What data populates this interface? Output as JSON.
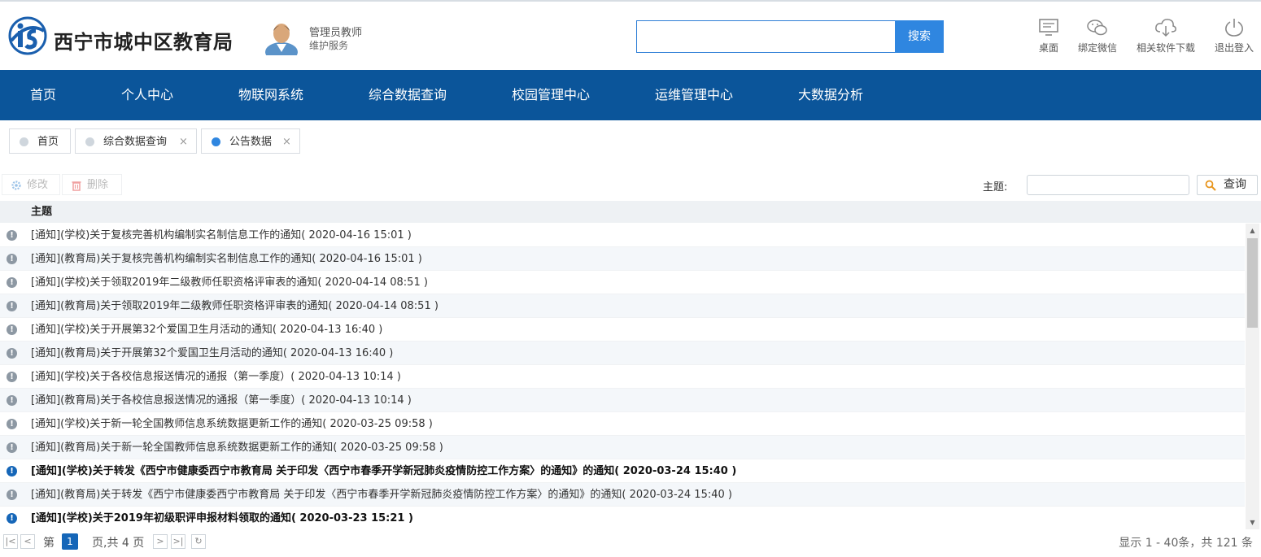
{
  "header": {
    "title": "西宁市城中区教育局",
    "user_role": "管理员教师",
    "user_service": "维护服务",
    "search_button": "搜索",
    "search_value": "",
    "tools": [
      {
        "label": "桌面",
        "icon": "desktop-icon"
      },
      {
        "label": "绑定微信",
        "icon": "wechat-icon"
      },
      {
        "label": "相关软件下载",
        "icon": "cloud-download-icon"
      },
      {
        "label": "退出登入",
        "icon": "power-icon"
      }
    ]
  },
  "nav": {
    "items": [
      "首页",
      "个人中心",
      "物联网系统",
      "综合数据查询",
      "校园管理中心",
      "运维管理中心",
      "大数据分析"
    ]
  },
  "tabs": [
    {
      "label": "首页",
      "closable": false,
      "active": false
    },
    {
      "label": "综合数据查询",
      "closable": true,
      "active": false
    },
    {
      "label": "公告数据",
      "closable": true,
      "active": true
    }
  ],
  "tab_close_symbol": "×",
  "toolbar": {
    "edit_label": "修改",
    "delete_label": "删除",
    "topic_label": "主题:",
    "topic_value": "",
    "query_label": "查询"
  },
  "table": {
    "column_header": "主题",
    "rows": [
      {
        "text": "[通知](学校)关于复核完善机构编制实名制信息工作的通知( 2020-04-16 15:01 )",
        "bold": false
      },
      {
        "text": "[通知](教育局)关于复核完善机构编制实名制信息工作的通知( 2020-04-16 15:01 )",
        "bold": false
      },
      {
        "text": "[通知](学校)关于领取2019年二级教师任职资格评审表的通知( 2020-04-14 08:51 )",
        "bold": false
      },
      {
        "text": "[通知](教育局)关于领取2019年二级教师任职资格评审表的通知( 2020-04-14 08:51 )",
        "bold": false
      },
      {
        "text": "[通知](学校)关于开展第32个爱国卫生月活动的通知( 2020-04-13 16:40 )",
        "bold": false
      },
      {
        "text": "[通知](教育局)关于开展第32个爱国卫生月活动的通知( 2020-04-13 16:40 )",
        "bold": false
      },
      {
        "text": "[通知](学校)关于各校信息报送情况的通报（第一季度）( 2020-04-13 10:14 )",
        "bold": false
      },
      {
        "text": "[通知](教育局)关于各校信息报送情况的通报（第一季度）( 2020-04-13 10:14 )",
        "bold": false
      },
      {
        "text": "[通知](学校)关于新一轮全国教师信息系统数据更新工作的通知( 2020-03-25 09:58 )",
        "bold": false
      },
      {
        "text": "[通知](教育局)关于新一轮全国教师信息系统数据更新工作的通知( 2020-03-25 09:58 )",
        "bold": false
      },
      {
        "text": "[通知](学校)关于转发《西宁市健康委西宁市教育局 关于印发〈西宁市春季开学新冠肺炎疫情防控工作方案〉的通知》的通知( 2020-03-24 15:40 )",
        "bold": true
      },
      {
        "text": "[通知](教育局)关于转发《西宁市健康委西宁市教育局 关于印发〈西宁市春季开学新冠肺炎疫情防控工作方案〉的通知》的通知( 2020-03-24 15:40 )",
        "bold": false
      },
      {
        "text": "[通知](学校)关于2019年初级职评申报材料领取的通知( 2020-03-23 15:21 )",
        "bold": true
      }
    ]
  },
  "pager": {
    "page_prefix": "第",
    "current_page": "1",
    "page_suffix": "页,共 4 页",
    "summary": "显示 1 - 40条，共 121 条"
  },
  "colors": {
    "nav_bg": "#0b559a",
    "accent": "#2f86e0",
    "unread_icon": "#1566b8",
    "read_icon": "#8d98a3"
  }
}
